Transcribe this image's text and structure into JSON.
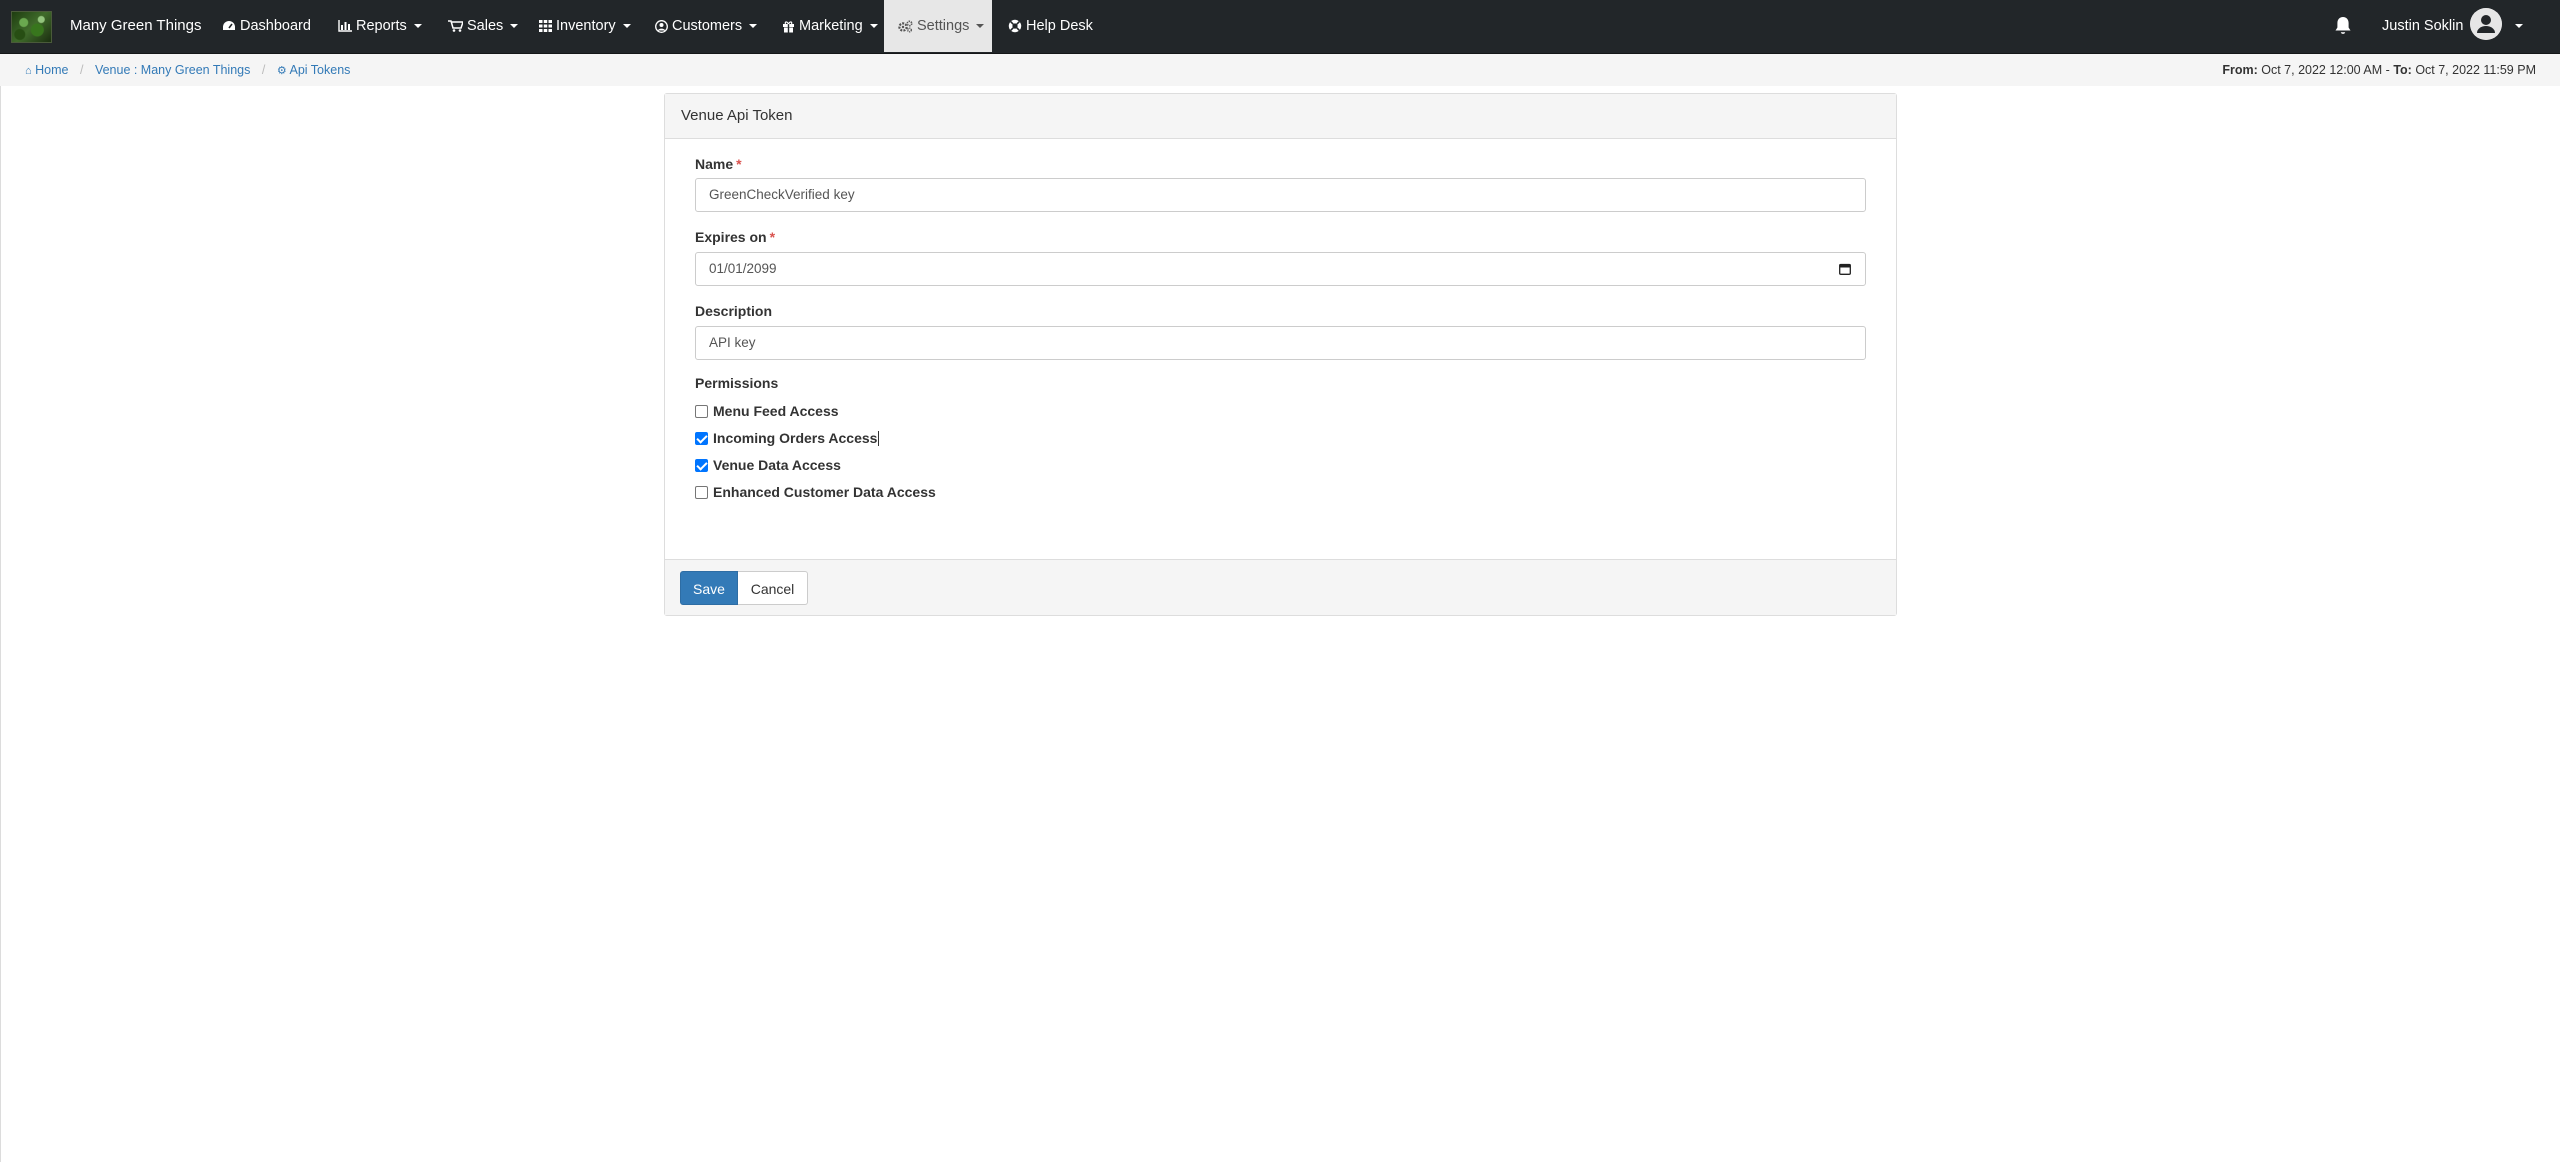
{
  "navbar": {
    "brand": "Many Green Things",
    "items": [
      {
        "label": "Dashboard",
        "icon": "dashboard-icon"
      },
      {
        "label": "Reports",
        "icon": "bar-chart-icon"
      },
      {
        "label": "Sales",
        "icon": "cart-icon"
      },
      {
        "label": "Inventory",
        "icon": "grid-icon"
      },
      {
        "label": "Customers",
        "icon": "user-circle-icon"
      },
      {
        "label": "Marketing",
        "icon": "gift-icon"
      },
      {
        "label": "Settings",
        "icon": "gears-icon",
        "active": true
      },
      {
        "label": "Help Desk",
        "icon": "lifebuoy-icon"
      }
    ],
    "user_name": "Justin Soklin"
  },
  "breadcrumb": {
    "home": "Home",
    "venue": "Venue : Many Green Things",
    "current": "Api Tokens"
  },
  "date_range": {
    "from_label": "From:",
    "from_value": "Oct 7, 2022 12:00 AM",
    "separator": "-",
    "to_label": "To:",
    "to_value": "Oct 7, 2022 11:59 PM"
  },
  "form": {
    "title": "Venue Api Token",
    "name_label": "Name",
    "name_value": "GreenCheckVerified key",
    "expires_label": "Expires on",
    "expires_value": "01/01/2099",
    "description_label": "Description",
    "description_value": "API key",
    "required_mark": "*",
    "permissions_label": "Permissions",
    "permissions": [
      {
        "label": "Menu Feed Access",
        "checked": false
      },
      {
        "label": "Incoming Orders Access",
        "checked": true
      },
      {
        "label": "Venue Data Access",
        "checked": true
      },
      {
        "label": "Enhanced Customer Data Access",
        "checked": false
      }
    ],
    "save_label": "Save",
    "cancel_label": "Cancel"
  },
  "colors": {
    "navbar_bg": "#222629",
    "primary": "#337ab7",
    "link": "#337ab7",
    "required": "#d9534f",
    "checkbox_checked": "#0075ff"
  }
}
